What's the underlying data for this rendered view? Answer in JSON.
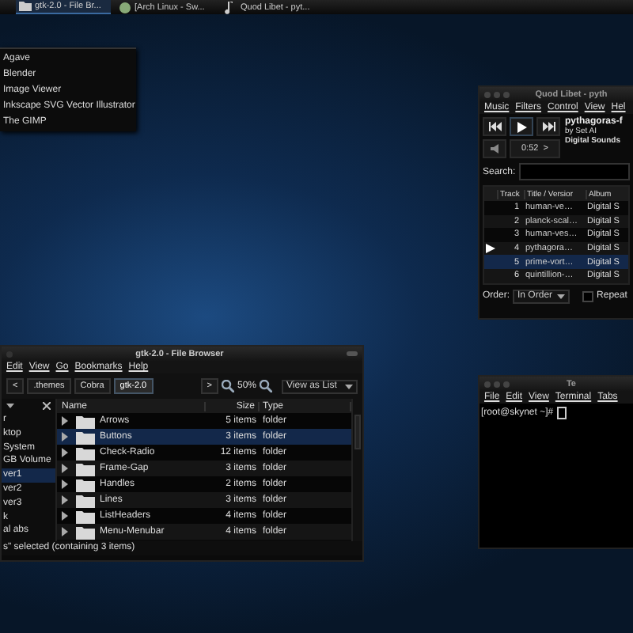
{
  "taskbar": {
    "tasks": [
      {
        "label": "gtk-2.0 - File Br...",
        "selected": true,
        "kind": "folder"
      },
      {
        "label": "[Arch Linux - Sw...",
        "selected": false,
        "kind": "browser"
      },
      {
        "label": "Quod Libet - pyt...",
        "selected": false,
        "kind": "music"
      }
    ]
  },
  "app_menu": {
    "items": [
      "Agave",
      "Blender",
      "Image Viewer",
      "Inkscape SVG Vector Illustrator",
      "The GIMP"
    ]
  },
  "quod_libet": {
    "title": "Quod Libet - pyth",
    "menu": [
      "Music",
      "Filters",
      "Control",
      "View",
      "Hel"
    ],
    "song": {
      "title": "pythagoras-f",
      "artist": "by Set AI",
      "album": "Digital Sounds"
    },
    "time": "0:52",
    "time_arrow": ">",
    "search_label": "Search:",
    "columns": [
      "Track",
      "Title / Versior",
      "Album"
    ],
    "rows": [
      {
        "track": "1",
        "title": "human-ve…",
        "album": "Digital S",
        "playing": false,
        "selected": false
      },
      {
        "track": "2",
        "title": "planck-scal…",
        "album": "Digital S",
        "playing": false,
        "selected": false
      },
      {
        "track": "3",
        "title": "human-ves…",
        "album": "Digital S",
        "playing": false,
        "selected": false
      },
      {
        "track": "4",
        "title": "pythagora…",
        "album": "Digital S",
        "playing": true,
        "selected": false
      },
      {
        "track": "5",
        "title": "prime-vort…",
        "album": "Digital S",
        "playing": false,
        "selected": true
      },
      {
        "track": "6",
        "title": "quintillion-…",
        "album": "Digital S",
        "playing": false,
        "selected": false
      }
    ],
    "order_label": "Order:",
    "order": "In Order",
    "repeat": {
      "label": "Repeat",
      "checked": false
    }
  },
  "file_browser": {
    "title": "gtk-2.0 - File Browser",
    "menu": [
      "Edit",
      "View",
      "Go",
      "Bookmarks",
      "Help"
    ],
    "back": "<",
    "crumbs": [
      {
        "label": ".themes",
        "selected": false
      },
      {
        "label": "Cobra",
        "selected": false
      },
      {
        "label": "gtk-2.0",
        "selected": true
      }
    ],
    "forward": ">",
    "zoom": "50%",
    "view": "View as List",
    "sidebar": [
      {
        "label": "r",
        "selected": false
      },
      {
        "label": "ktop",
        "selected": false
      },
      {
        "label": "System",
        "selected": false
      },
      {
        "label": "GB Volume",
        "selected": false
      },
      {
        "label": "ver1",
        "selected": true
      },
      {
        "label": "ver2",
        "selected": false
      },
      {
        "label": "ver3",
        "selected": false
      },
      {
        "label": "k",
        "selected": false
      },
      {
        "label": "al abs",
        "selected": false
      }
    ],
    "columns": [
      "Name",
      "Size",
      "Type"
    ],
    "rows": [
      {
        "name": "Arrows",
        "size": "5 items",
        "type": "folder",
        "selected": false
      },
      {
        "name": "Buttons",
        "size": "3 items",
        "type": "folder",
        "selected": true
      },
      {
        "name": "Check-Radio",
        "size": "12 items",
        "type": "folder",
        "selected": false
      },
      {
        "name": "Frame-Gap",
        "size": "3 items",
        "type": "folder",
        "selected": false
      },
      {
        "name": "Handles",
        "size": "2 items",
        "type": "folder",
        "selected": false
      },
      {
        "name": "Lines",
        "size": "3 items",
        "type": "folder",
        "selected": false
      },
      {
        "name": "ListHeaders",
        "size": "4 items",
        "type": "folder",
        "selected": false
      },
      {
        "name": "Menu-Menubar",
        "size": "4 items",
        "type": "folder",
        "selected": false
      }
    ],
    "status": "s\" selected (containing 3 items)"
  },
  "terminal": {
    "title": "Te",
    "menu": [
      "File",
      "Edit",
      "View",
      "Terminal",
      "Tabs"
    ],
    "prompt": "[root@skynet ~]#"
  }
}
